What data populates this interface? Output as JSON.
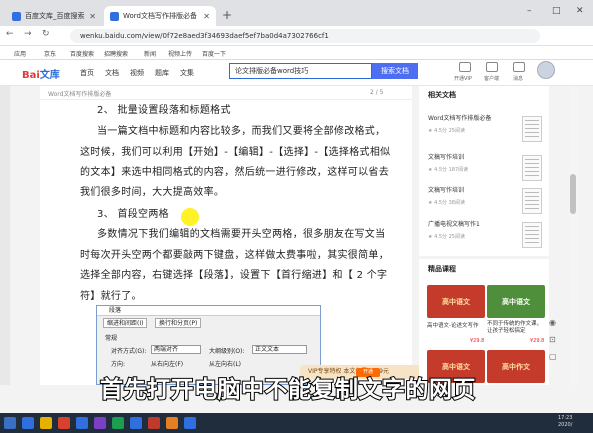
{
  "browser": {
    "tabs": [
      {
        "label": "百度文库_百度搜索"
      },
      {
        "label": "Word文档写作排版必备"
      }
    ],
    "new_tab": "+",
    "url": "wenku.baidu.com/view/0f72e8aed3f34693daef5ef7ba0d4a7302766cf1",
    "minimize": "–",
    "restore": "□",
    "close": "✕",
    "back": "←",
    "forward": "→",
    "reload": "↻"
  },
  "bookmarks": [
    "应用",
    "京东",
    "百度搜索",
    "招聘搜索",
    "新闻",
    "视频上传",
    "百度一下"
  ],
  "header": {
    "logo_a": "Bai",
    "logo_b": "文库",
    "nav": [
      "首页",
      "文档",
      "视频",
      "题库",
      "文集"
    ],
    "search_value": "论文排版必备word技巧",
    "search_button": "搜索文档",
    "icons": [
      "开通VIP",
      "客户端",
      "消息"
    ]
  },
  "doc": {
    "bar_title": "Word文档写作排版必备",
    "page": "2 / 5",
    "lines": [
      "2、 批量设置段落和标题格式",
      "当一篇文档中标题和内容比较多，而我们又要将全部修改格式，",
      "这时候，我们可以利用【开始】-【编辑】-【选择】-【选择格式相似",
      "的文本】来选中相同格式的内容，然后统一进行修改，这样可以省去",
      "我们很多时间，大大提高效率。",
      "3、 首段空两格",
      "多数情况下我们编辑的文档需要开头空两格，很多朋友在写文当",
      "时每次开头空两个都要敲两下键盘，这样做太费事啦，其实很简单，",
      "选择全部内容，右键选择【段落】，设置下【首行缩进】和【 2 个字",
      "符】就行了。"
    ]
  },
  "dialog": {
    "title": "段落",
    "tabs": [
      "缩进和间距(I)",
      "换行和分页(P)"
    ],
    "section": "常规",
    "align_label": "对齐方式(G):",
    "align_value": "两端对齐",
    "outline_label": "大纲级别(O):",
    "outline_value": "正文文本",
    "dir_label": "方向:",
    "dir_rtl": "从右向左(F)",
    "dir_ltr": "从左向右(L)"
  },
  "vip": {
    "text": "VIP专享特权  本文仅需￥0.9元",
    "button": "开通"
  },
  "caption": "首先打开电脑中不能复制文字的网页",
  "sidebar": {
    "related_title": "相关文档",
    "related": [
      {
        "title": "Word文档写作排版必备",
        "meta": "★ 4.5分  25阅读"
      },
      {
        "title": "文稿写作培训",
        "meta": "★ 4.5分  187阅读"
      },
      {
        "title": "文稿写作培训",
        "meta": "★ 4.5分  38阅读"
      },
      {
        "title": "广播电视文稿写作1",
        "meta": "★ 4.5分  25阅读"
      }
    ],
    "course_title": "精品课程",
    "courses": [
      {
        "thumb": "高中语文",
        "title": "高中语文-论述文写作",
        "price": "¥29.8"
      },
      {
        "thumb": "高中语文",
        "title": "不同于传统的作文课，让孩子轻松搞定",
        "price": "¥29.8"
      },
      {
        "thumb": "高中语文",
        "title": "",
        "price": ""
      },
      {
        "thumb": "高中作文",
        "title": "",
        "price": ""
      }
    ]
  },
  "taskbar": {
    "time": "17:23",
    "date": "2020/"
  }
}
